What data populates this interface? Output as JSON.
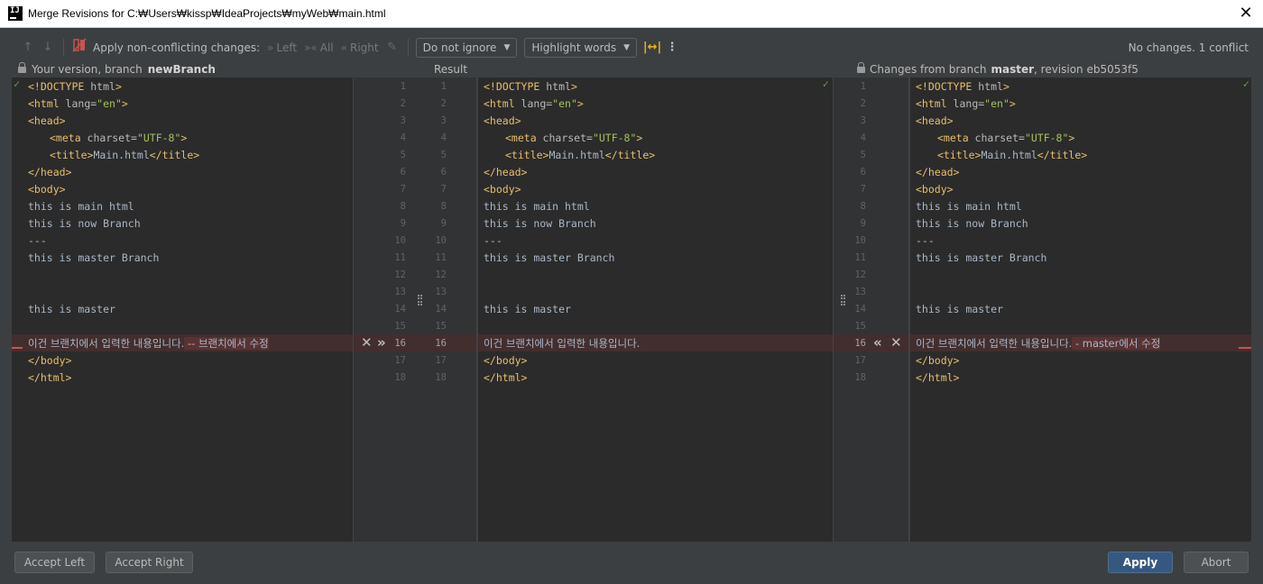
{
  "window": {
    "title": "Merge Revisions for C:₩Users₩kissp₩IdeaProjects₩myWeb₩main.html"
  },
  "toolbar": {
    "apply_label": "Apply non-conflicting changes:",
    "left_label": "Left",
    "all_label": "All",
    "right_label": "Right",
    "ignore_combo": "Do not ignore",
    "highlight_combo": "Highlight words",
    "status": "No changes. 1 conflict"
  },
  "headers": {
    "left_prefix": "Your version, branch",
    "left_branch": "newBranch",
    "result": "Result",
    "right_prefix": "Changes from branch",
    "right_branch": "master",
    "right_suffix": ", revision eb5053f5"
  },
  "line_numbers": [
    "1",
    "2",
    "3",
    "4",
    "5",
    "6",
    "7",
    "8",
    "9",
    "10",
    "11",
    "12",
    "13",
    "14",
    "15",
    "16",
    "17",
    "18"
  ],
  "code": {
    "doctype": "<!DOCTYPE",
    "doctype_html": " html",
    "doctype_close": ">",
    "html_open": "<html",
    "lang_attr": " lang=",
    "lang_val": "\"en\"",
    "gt": ">",
    "head_open": "<head>",
    "meta_open": "<meta",
    "charset_attr": " charset=",
    "charset_val": "\"UTF-8\"",
    "title_open": "<title>",
    "title_text": "Main.html",
    "title_close": "</title>",
    "head_close": "</head>",
    "body_open": "<body>",
    "line8": "this is main html",
    "line9": "this is now Branch",
    "line10": "---",
    "line11": "this is master Branch",
    "line14": "this is master",
    "line16_base": "이건 브랜치에서 입력한 내용입니다.",
    "line16_left_change": " -- 브랜치에서 수정",
    "line16_right_change": " - master에서 수정",
    "body_close": "</body>",
    "html_close": "</html>"
  },
  "buttons": {
    "accept_left": "Accept Left",
    "accept_right": "Accept Right",
    "apply": "Apply",
    "abort": "Abort"
  }
}
